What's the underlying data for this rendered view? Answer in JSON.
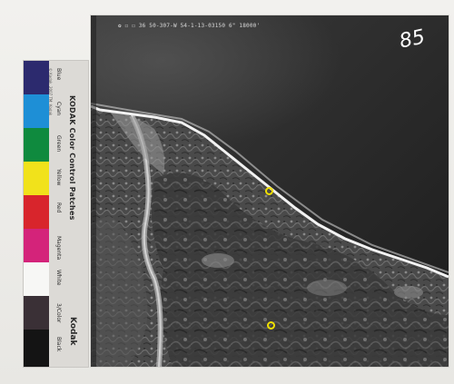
{
  "photo": {
    "header_text": "✿ ☐ ☐ 36   50-307-W   54-1-13-03150   6\"   18000'",
    "number": "85",
    "markers": [
      {
        "name": "offshore-marker"
      },
      {
        "name": "inland-marker"
      }
    ]
  },
  "color_strip": {
    "brand_title": "KODAK Color Control Patches",
    "brand_name": "Kodak",
    "labels": [
      "Blue",
      "Cyan",
      "Green",
      "Yellow",
      "Red",
      "Magenta",
      "White",
      "3/Color",
      "Black"
    ],
    "fine_print": "© Kodak, 2007   TM: Kodak",
    "colors": {
      "blue": "#2c2a6e",
      "cyan": "#1e8fd6",
      "green": "#0f8a3e",
      "yellow": "#f1e21b",
      "red": "#d8252c",
      "magenta": "#d4237a",
      "white": "#f7f7f5",
      "three_color": "#3a3036",
      "black": "#141414"
    }
  }
}
